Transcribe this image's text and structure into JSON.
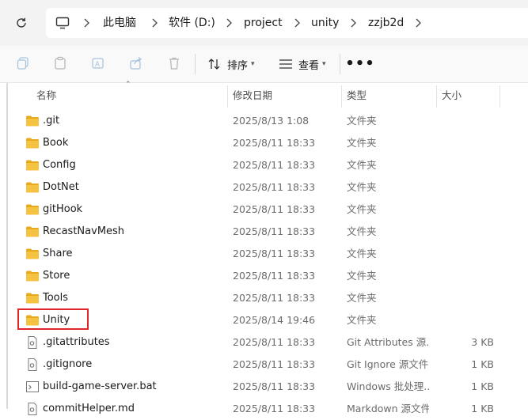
{
  "address": {
    "crumbs": [
      "此电脑",
      "软件 (D:)",
      "project",
      "unity",
      "zzjb2d"
    ]
  },
  "toolbar": {
    "sort_label": "排序",
    "view_label": "查看",
    "more_label": "•••"
  },
  "columns": {
    "name": "名称",
    "modified": "修改日期",
    "type": "类型",
    "size": "大小"
  },
  "files": [
    {
      "name": ".git",
      "modified": "2025/8/13 1:08",
      "type": "文件夹",
      "size": "",
      "icon": "folder-icon"
    },
    {
      "name": "Book",
      "modified": "2025/8/11 18:33",
      "type": "文件夹",
      "size": "",
      "icon": "folder-icon"
    },
    {
      "name": "Config",
      "modified": "2025/8/11 18:33",
      "type": "文件夹",
      "size": "",
      "icon": "folder-icon"
    },
    {
      "name": "DotNet",
      "modified": "2025/8/11 18:33",
      "type": "文件夹",
      "size": "",
      "icon": "folder-icon"
    },
    {
      "name": "gitHook",
      "modified": "2025/8/11 18:33",
      "type": "文件夹",
      "size": "",
      "icon": "folder-icon"
    },
    {
      "name": "RecastNavMesh",
      "modified": "2025/8/11 18:33",
      "type": "文件夹",
      "size": "",
      "icon": "folder-icon"
    },
    {
      "name": "Share",
      "modified": "2025/8/11 18:33",
      "type": "文件夹",
      "size": "",
      "icon": "folder-icon"
    },
    {
      "name": "Store",
      "modified": "2025/8/11 18:33",
      "type": "文件夹",
      "size": "",
      "icon": "folder-icon"
    },
    {
      "name": "Tools",
      "modified": "2025/8/11 18:33",
      "type": "文件夹",
      "size": "",
      "icon": "folder-icon"
    },
    {
      "name": "Unity",
      "modified": "2025/8/14 19:46",
      "type": "文件夹",
      "size": "",
      "icon": "folder-icon"
    },
    {
      "name": ".gitattributes",
      "modified": "2025/8/11 18:33",
      "type": "Git Attributes 源...",
      "size": "3 KB",
      "icon": "text-file-icon"
    },
    {
      "name": ".gitignore",
      "modified": "2025/8/11 18:33",
      "type": "Git Ignore 源文件",
      "size": "1 KB",
      "icon": "text-file-icon"
    },
    {
      "name": "build-game-server.bat",
      "modified": "2025/8/11 18:33",
      "type": "Windows 批处理...",
      "size": "1 KB",
      "icon": "batch-file-icon"
    },
    {
      "name": "commitHelper.md",
      "modified": "2025/8/11 18:33",
      "type": "Markdown 源文件",
      "size": "1 KB",
      "icon": "text-file-icon"
    }
  ],
  "highlight": {
    "row_name": "Unity",
    "color": "#e0242a"
  },
  "colors": {
    "folder": "#f5c242",
    "folder_dark": "#e8a91d"
  }
}
